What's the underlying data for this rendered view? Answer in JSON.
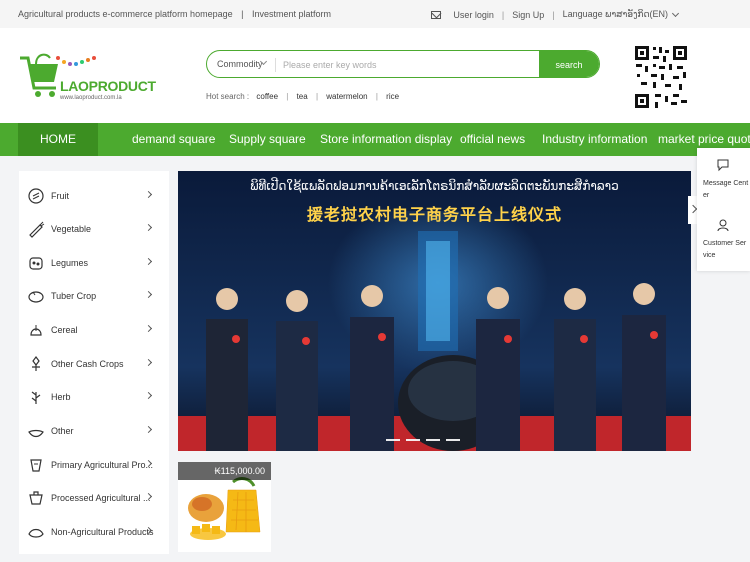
{
  "topbar": {
    "left_links": [
      "Agricultural products e-commerce platform homepage",
      "|",
      "Investment platform"
    ],
    "user_login": "User login",
    "sign_up": "Sign Up",
    "language": "Language ພາສາອັງກິດ(EN)"
  },
  "logo": {
    "name": "LAOPRODUCT",
    "url_text": "www.laoproduct.com.la"
  },
  "search": {
    "category": "Commodity",
    "placeholder": "Please enter key words",
    "button": "search",
    "hot_label": "Hot search :",
    "hot_keywords": [
      "coffee",
      "tea",
      "watermelon",
      "rice"
    ]
  },
  "nav": {
    "items": [
      "HOME",
      "demand square",
      "Supply square",
      "Store information display",
      "official news",
      "Industry information",
      "market price quotes"
    ]
  },
  "categories": [
    {
      "label": "Fruit",
      "icon": "fruit-icon"
    },
    {
      "label": "Vegetable",
      "icon": "vegetable-icon"
    },
    {
      "label": "Legumes",
      "icon": "legumes-icon"
    },
    {
      "label": "Tuber Crop",
      "icon": "tuber-icon"
    },
    {
      "label": "Cereal",
      "icon": "cereal-icon"
    },
    {
      "label": "Other Cash Crops",
      "icon": "cash-crops-icon"
    },
    {
      "label": "Herb",
      "icon": "herb-icon"
    },
    {
      "label": "Other",
      "icon": "other-icon"
    },
    {
      "label": "Primary Agricultural Pro...",
      "icon": "primary-products-icon"
    },
    {
      "label": "Processed Agricultural ...",
      "icon": "processed-products-icon"
    },
    {
      "label": "Non-Agricultural Products",
      "icon": "non-agricultural-icon"
    }
  ],
  "banner": {
    "title_lao": "ພິທີເປີດໃຊ້ແພລັດຟອມການຄ້າເອເລັກໂຕຣນິກສຳລັບຜະລິດຕະພັນກະສິກຳລາວ",
    "title_cn": "援老挝农村电子商务平台上线仪式"
  },
  "product": {
    "price": "₭115,000.00",
    "image": "mango"
  },
  "side_panel": {
    "message_center": "Message Center",
    "customer_service": "Customer Service"
  },
  "colors": {
    "brand_green": "#4caa2f",
    "nav_active": "#3b8f20"
  }
}
